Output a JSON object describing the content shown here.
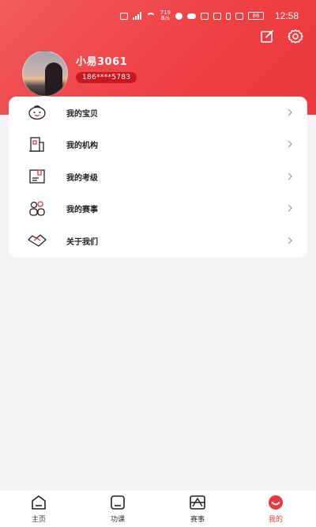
{
  "status_bar": {
    "speed": "719\nB/s",
    "battery": "86",
    "time": "12:58"
  },
  "profile": {
    "username": "小易3061",
    "phone": "186****5783"
  },
  "header_actions": {
    "edit_icon": "edit-icon",
    "settings_icon": "gear-icon"
  },
  "menu": {
    "items": [
      {
        "label": "我的宝贝",
        "icon": "baby-face-icon"
      },
      {
        "label": "我的机构",
        "icon": "building-icon"
      },
      {
        "label": "我的考级",
        "icon": "exam-certificate-icon"
      },
      {
        "label": "我的赛事",
        "icon": "group-people-icon"
      },
      {
        "label": "关于我们",
        "icon": "handshake-icon"
      }
    ]
  },
  "tabbar": {
    "items": [
      {
        "label": "主页",
        "icon": "home-icon",
        "active": false
      },
      {
        "label": "功课",
        "icon": "homework-icon",
        "active": false
      },
      {
        "label": "赛事",
        "icon": "competition-icon",
        "active": false
      },
      {
        "label": "我的",
        "icon": "smile-icon",
        "active": true
      }
    ]
  },
  "colors": {
    "accent": "#e83a3e",
    "header_gradient_start": "#f25a5c",
    "header_gradient_end": "#ec3a3e",
    "badge": "#c8191e",
    "background": "#f4f4f6"
  }
}
